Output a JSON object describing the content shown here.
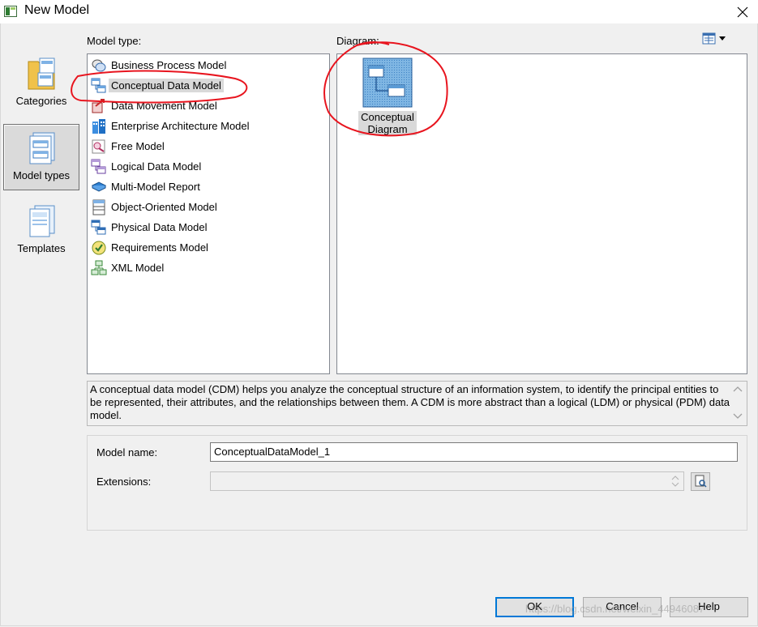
{
  "window": {
    "title": "New Model",
    "close_symbol": "✕"
  },
  "categories": [
    {
      "label": "Categories",
      "icon": "folder-icon",
      "selected": false
    },
    {
      "label": "Model types",
      "icon": "model-types-icon",
      "selected": true
    },
    {
      "label": "Templates",
      "icon": "templates-icon",
      "selected": false
    }
  ],
  "model_type": {
    "label": "Model type:",
    "items": [
      {
        "label": "Business Process Model",
        "icon": "business-process-icon"
      },
      {
        "label": "Conceptual Data Model",
        "icon": "conceptual-data-icon",
        "selected": true
      },
      {
        "label": "Data Movement Model",
        "icon": "data-movement-icon"
      },
      {
        "label": "Enterprise Architecture Model",
        "icon": "enterprise-architecture-icon"
      },
      {
        "label": "Free Model",
        "icon": "free-model-icon"
      },
      {
        "label": "Logical Data Model",
        "icon": "logical-data-icon"
      },
      {
        "label": "Multi-Model Report",
        "icon": "report-icon"
      },
      {
        "label": "Object-Oriented Model",
        "icon": "object-oriented-icon"
      },
      {
        "label": "Physical Data Model",
        "icon": "physical-data-icon"
      },
      {
        "label": "Requirements Model",
        "icon": "requirements-icon"
      },
      {
        "label": "XML Model",
        "icon": "xml-model-icon"
      }
    ]
  },
  "diagram": {
    "label": "Diagram:",
    "view_toggle_icon": "view-options-icon",
    "items": [
      {
        "label_line1": "Conceptual",
        "label_line2": "Diagram",
        "icon": "conceptual-diagram-icon",
        "selected": true
      }
    ]
  },
  "description": "A conceptual data model (CDM) helps you analyze the conceptual structure of an information system, to identify the principal entities to be represented, their attributes, and the relationships between them. A CDM is more abstract than a logical (LDM) or physical (PDM) data model.",
  "properties": {
    "model_name_label": "Model name:",
    "model_name_value": "ConceptualDataModel_1",
    "extensions_label": "Extensions:",
    "extensions_value": ""
  },
  "buttons": {
    "ok": "OK",
    "cancel": "Cancel",
    "help": "Help"
  },
  "watermark": "https://blog.csdn.net/weixin_44946087",
  "colors": {
    "annotation": "#e8141e",
    "focus": "#0078d7"
  }
}
